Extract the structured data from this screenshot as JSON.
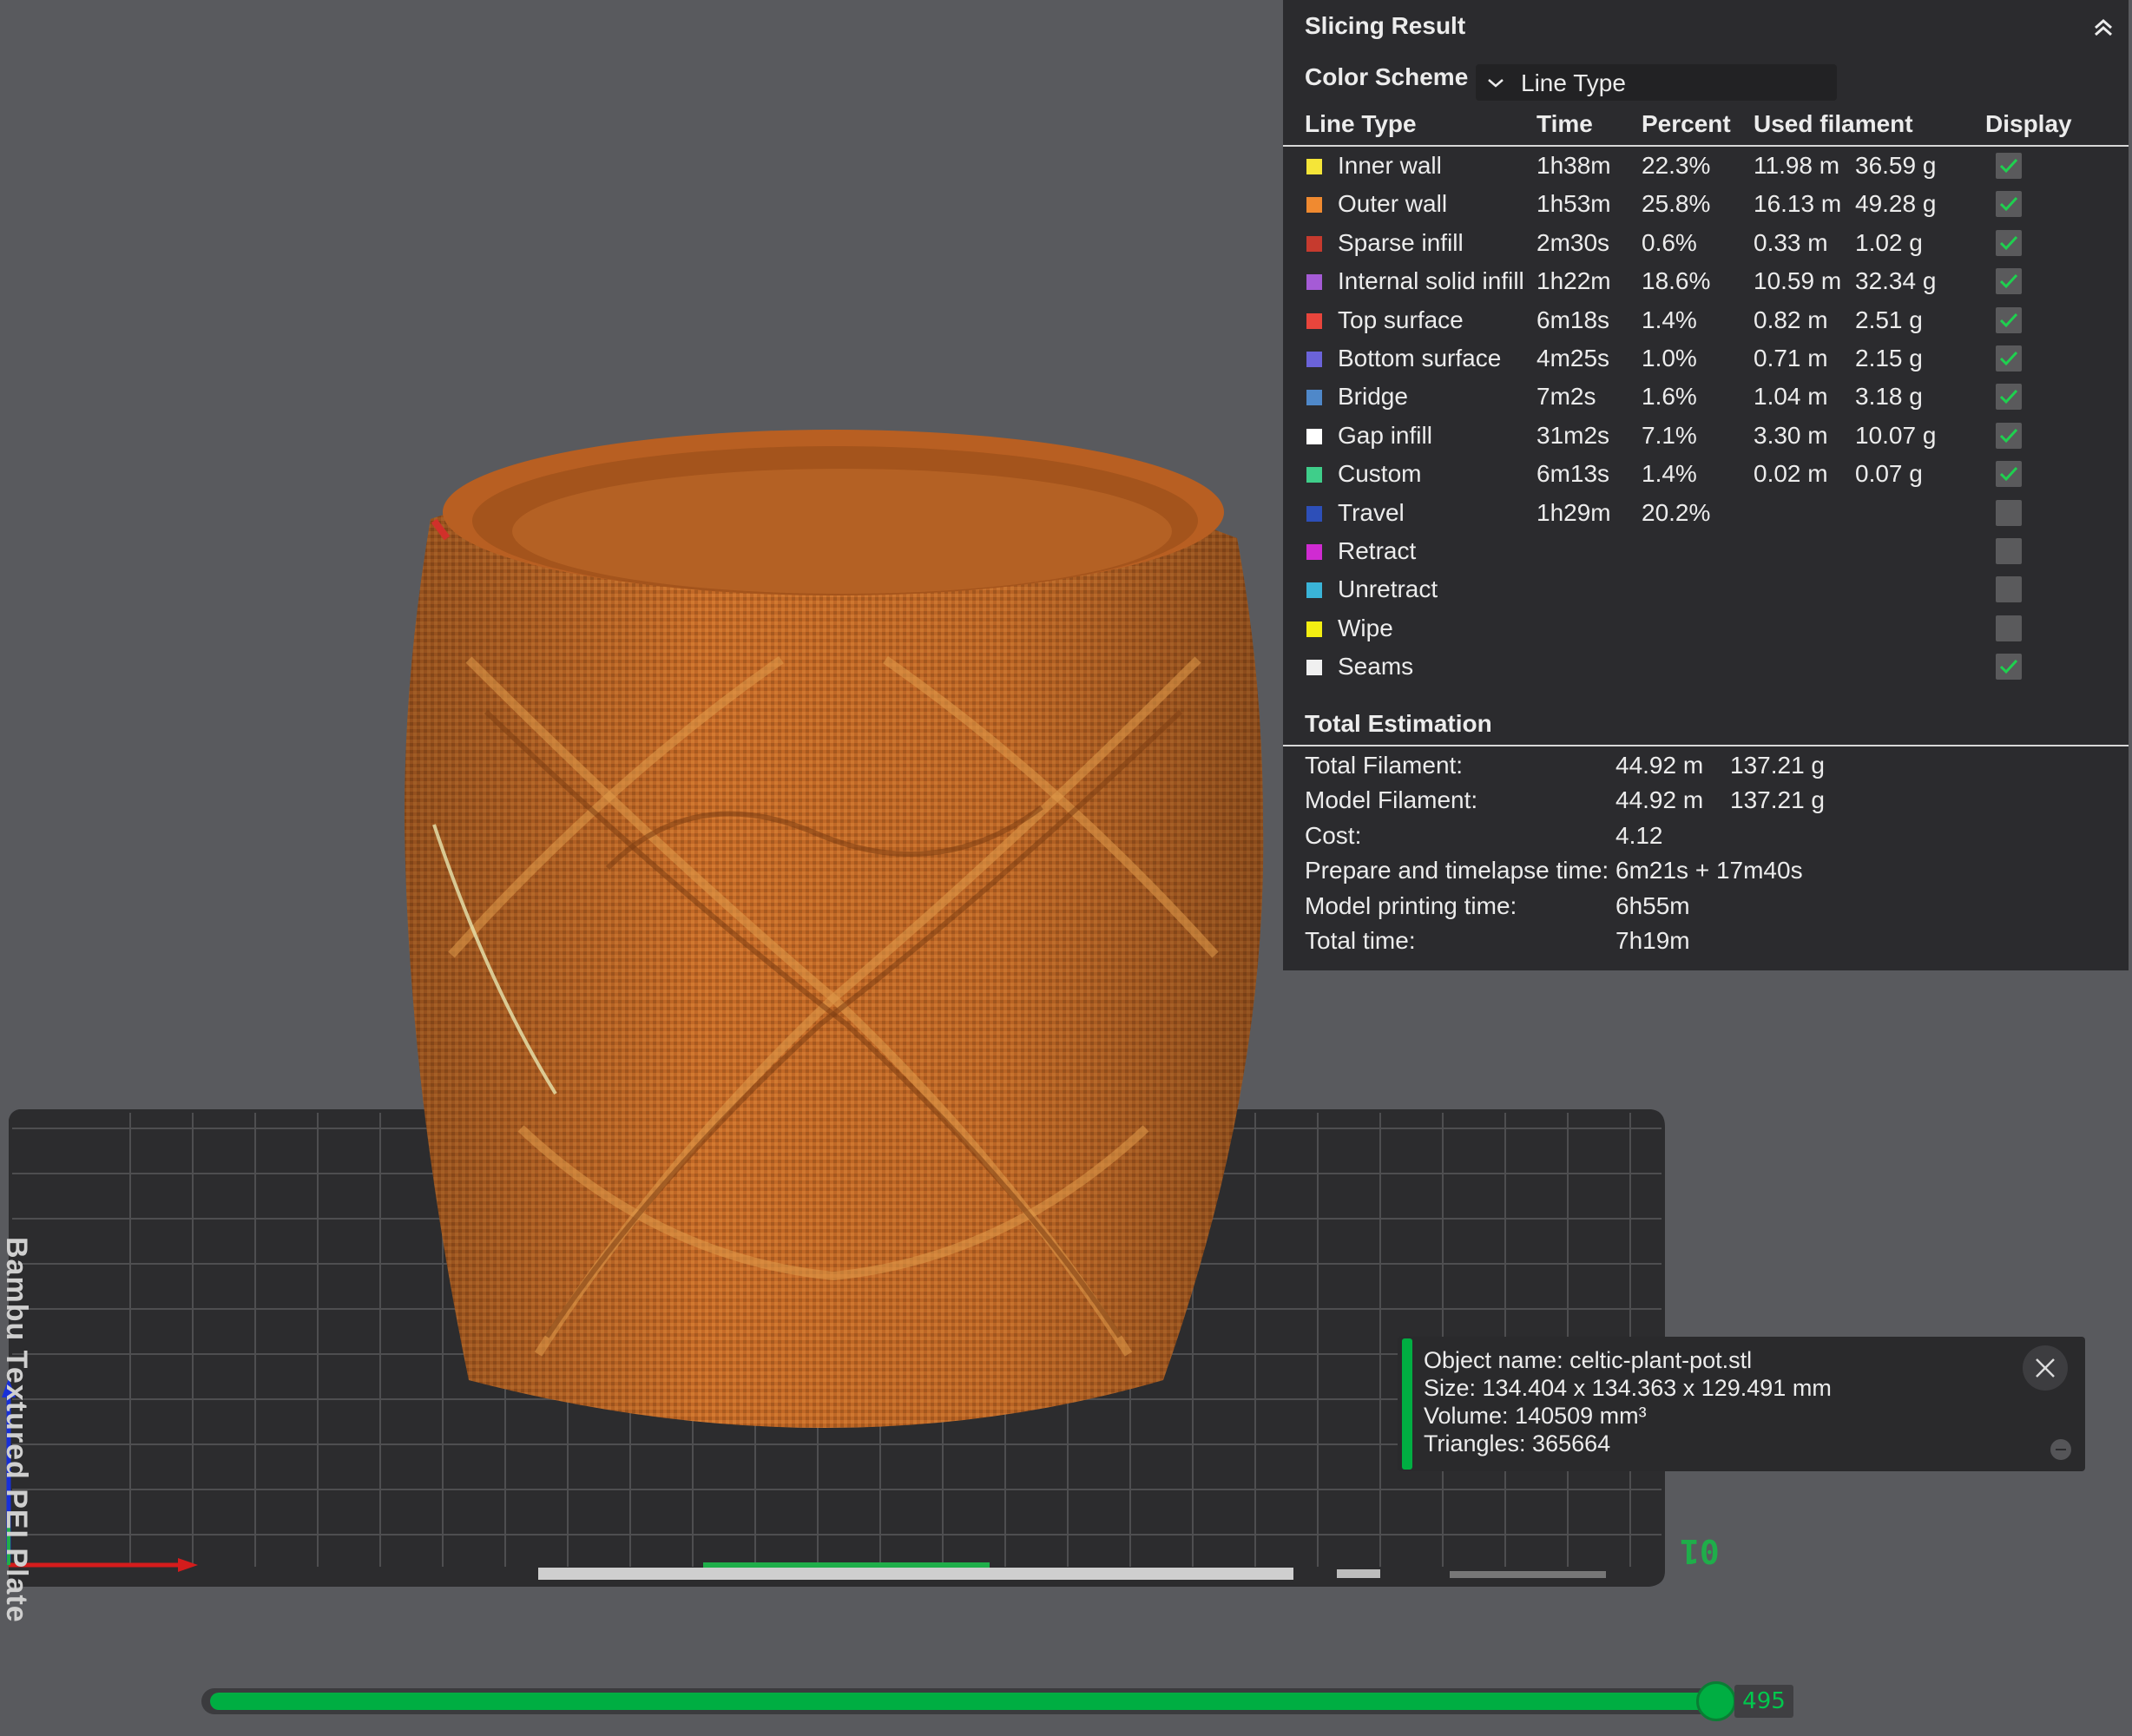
{
  "bed_label": "Bambu Textured PEI Plate",
  "plate_number": "01",
  "colors": {
    "accent": "#00ae42",
    "panel_bg": "#2b2b2e",
    "model": "#c46a27"
  },
  "slicing_result": {
    "title": "Slicing Result",
    "color_scheme_label": "Color Scheme",
    "color_scheme_value": "Line Type",
    "columns": {
      "line_type": "Line Type",
      "time": "Time",
      "percent": "Percent",
      "used_filament": "Used filament",
      "display": "Display"
    },
    "rows": [
      {
        "name": "Inner wall",
        "color": "#f5e538",
        "time": "1h38m",
        "percent": "22.3%",
        "length": "11.98 m",
        "weight": "36.59 g",
        "display": true
      },
      {
        "name": "Outer wall",
        "color": "#f08a30",
        "time": "1h53m",
        "percent": "25.8%",
        "length": "16.13 m",
        "weight": "49.28 g",
        "display": true
      },
      {
        "name": "Sparse infill",
        "color": "#c63a2e",
        "time": "2m30s",
        "percent": "0.6%",
        "length": "0.33 m",
        "weight": "1.02 g",
        "display": true
      },
      {
        "name": "Internal solid infill",
        "color": "#a55bd6",
        "time": "1h22m",
        "percent": "18.6%",
        "length": "10.59 m",
        "weight": "32.34 g",
        "display": true
      },
      {
        "name": "Top surface",
        "color": "#e8453c",
        "time": "6m18s",
        "percent": "1.4%",
        "length": "0.82 m",
        "weight": "2.51 g",
        "display": true
      },
      {
        "name": "Bottom surface",
        "color": "#6b63d9",
        "time": "4m25s",
        "percent": "1.0%",
        "length": "0.71 m",
        "weight": "2.15 g",
        "display": true
      },
      {
        "name": "Bridge",
        "color": "#4f88c9",
        "time": "7m2s",
        "percent": "1.6%",
        "length": "1.04 m",
        "weight": "3.18 g",
        "display": true
      },
      {
        "name": "Gap infill",
        "color": "#ffffff",
        "time": "31m2s",
        "percent": "7.1%",
        "length": "3.30 m",
        "weight": "10.07 g",
        "display": true
      },
      {
        "name": "Custom",
        "color": "#3fce8a",
        "time": "6m13s",
        "percent": "1.4%",
        "length": "0.02 m",
        "weight": "0.07 g",
        "display": true
      },
      {
        "name": "Travel",
        "color": "#2d4fb8",
        "time": "1h29m",
        "percent": "20.2%",
        "length": "",
        "weight": "",
        "display": false
      },
      {
        "name": "Retract",
        "color": "#d02bd2",
        "time": "",
        "percent": "",
        "length": "",
        "weight": "",
        "display": false
      },
      {
        "name": "Unretract",
        "color": "#3ab4d8",
        "time": "",
        "percent": "",
        "length": "",
        "weight": "",
        "display": false
      },
      {
        "name": "Wipe",
        "color": "#f3ee12",
        "time": "",
        "percent": "",
        "length": "",
        "weight": "",
        "display": false
      },
      {
        "name": "Seams",
        "color": "#f0f0f0",
        "time": "",
        "percent": "",
        "length": "",
        "weight": "",
        "display": true
      }
    ],
    "total_estimation": {
      "title": "Total Estimation",
      "rows": [
        {
          "label": "Total Filament:",
          "v1": "44.92 m",
          "v2": "137.21 g"
        },
        {
          "label": "Model Filament:",
          "v1": "44.92 m",
          "v2": "137.21 g"
        },
        {
          "label": "Cost:",
          "v1": "4.12",
          "v2": ""
        },
        {
          "label": "Prepare and timelapse time:",
          "v1": "6m21s + 17m40s",
          "v2": ""
        },
        {
          "label": "Model printing time:",
          "v1": "6h55m",
          "v2": ""
        },
        {
          "label": "Total time:",
          "v1": "7h19m",
          "v2": ""
        }
      ]
    }
  },
  "object_info": {
    "name_line": "Object name: celtic-plant-pot.stl",
    "size_line": "Size: 134.404 x 134.363 x 129.491 mm",
    "volume_line": "Volume: 140509 mm³",
    "triangles_line": "Triangles: 365664"
  },
  "layer_slider": {
    "value": "495",
    "fraction": 1.0
  }
}
